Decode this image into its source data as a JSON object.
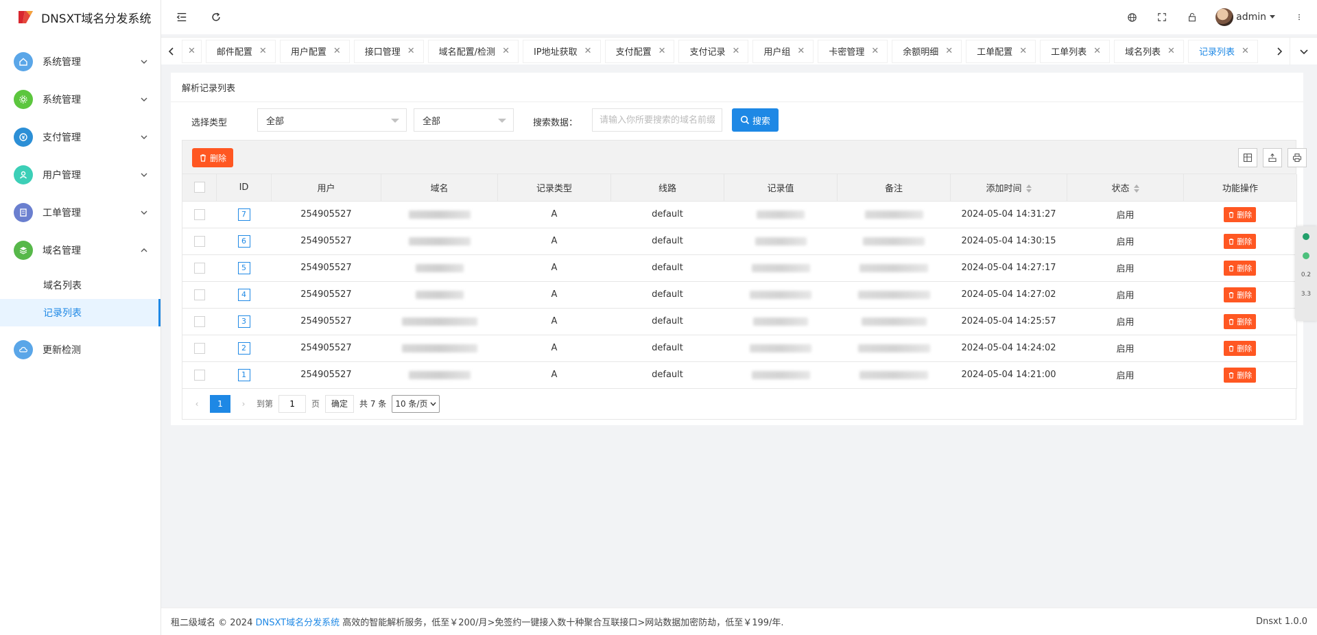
{
  "app": {
    "title": "DNSXT域名分发系统"
  },
  "sidebar": {
    "items": [
      {
        "label": "系统管理",
        "color": "#5aa6e8"
      },
      {
        "label": "系统管理",
        "color": "#5cc63e"
      },
      {
        "label": "支付管理",
        "color": "#2c8fd6"
      },
      {
        "label": "用户管理",
        "color": "#3ccfb7"
      },
      {
        "label": "工单管理",
        "color": "#6a7fcf"
      },
      {
        "label": "域名管理",
        "color": "#57b84a"
      }
    ],
    "sub_items": [
      {
        "label": "域名列表"
      },
      {
        "label": "记录列表"
      }
    ],
    "extra_item": {
      "label": "更新检测",
      "color": "#5aa6e8"
    }
  },
  "header": {
    "user": "admin"
  },
  "tabs": [
    {
      "label": "邮件配置"
    },
    {
      "label": "用户配置"
    },
    {
      "label": "接口管理"
    },
    {
      "label": "域名配置/检测"
    },
    {
      "label": "IP地址获取"
    },
    {
      "label": "支付配置"
    },
    {
      "label": "支付记录"
    },
    {
      "label": "用户组"
    },
    {
      "label": "卡密管理"
    },
    {
      "label": "余额明细"
    },
    {
      "label": "工单配置"
    },
    {
      "label": "工单列表"
    },
    {
      "label": "域名列表"
    },
    {
      "label": "记录列表"
    }
  ],
  "panel": {
    "title": "解析记录列表",
    "filter_label": "选择类型",
    "select1": "全部",
    "select2": "全部",
    "search_label": "搜索数据：",
    "search_placeholder": "请输入你所要搜索的域名前缀",
    "search_button": "搜索",
    "delete_button": "删除"
  },
  "table": {
    "headers": [
      "ID",
      "用户",
      "域名",
      "记录类型",
      "线路",
      "记录值",
      "备注",
      "添加时间",
      "状态",
      "功能操作"
    ],
    "rows": [
      {
        "id": "7",
        "user": "254905527",
        "type": "A",
        "line": "default",
        "value": "...0.1",
        "note": "...2011",
        "time": "2024-05-04 14:31:27",
        "status": "启用",
        "action": "删除"
      },
      {
        "id": "6",
        "user": "254905527",
        "type": "A",
        "line": "default",
        "value": "...1",
        "note": "...988",
        "time": "2024-05-04 14:30:15",
        "status": "启用",
        "action": "删除"
      },
      {
        "id": "5",
        "user": "254905527",
        "type": "A",
        "line": "default",
        "value": "",
        "note": "",
        "time": "2024-05-04 14:27:17",
        "status": "启用",
        "action": "删除"
      },
      {
        "id": "4",
        "user": "254905527",
        "type": "A",
        "line": "default",
        "value": "",
        "note": "",
        "time": "2024-05-04 14:27:02",
        "status": "启用",
        "action": "删除"
      },
      {
        "id": "3",
        "user": "254905527",
        "type": "A",
        "line": "default",
        "value": "",
        "note": "...000",
        "time": "2024-05-04 14:25:57",
        "status": "启用",
        "action": "删除"
      },
      {
        "id": "2",
        "user": "254905527",
        "type": "A",
        "line": "default",
        "value": "...17",
        "note": "...5910",
        "time": "2024-05-04 14:24:02",
        "status": "启用",
        "action": "删除"
      },
      {
        "id": "1",
        "user": "254905527",
        "type": "A",
        "line": "default",
        "value": "...)",
        "note": "微信 V...",
        "time": "2024-05-04 14:21:00",
        "status": "启用",
        "action": "删除"
      }
    ]
  },
  "pager": {
    "current": "1",
    "goto_label": "到第",
    "goto_value": "1",
    "page_unit": "页",
    "confirm": "确定",
    "total": "共 7 条",
    "page_size": "10 条/页"
  },
  "footer": {
    "prefix": "租二级域名 © 2024",
    "link": "DNSXT域名分发系统",
    "text": "高效的智能解析服务，低至￥200/月>免签约一键接入数十种聚合互联接口>网站数据加密防劫，低至￥199/年.",
    "version": "Dnsxt 1.0.0"
  },
  "net_widget": {
    "up": "0.2",
    "down": "3.3"
  }
}
